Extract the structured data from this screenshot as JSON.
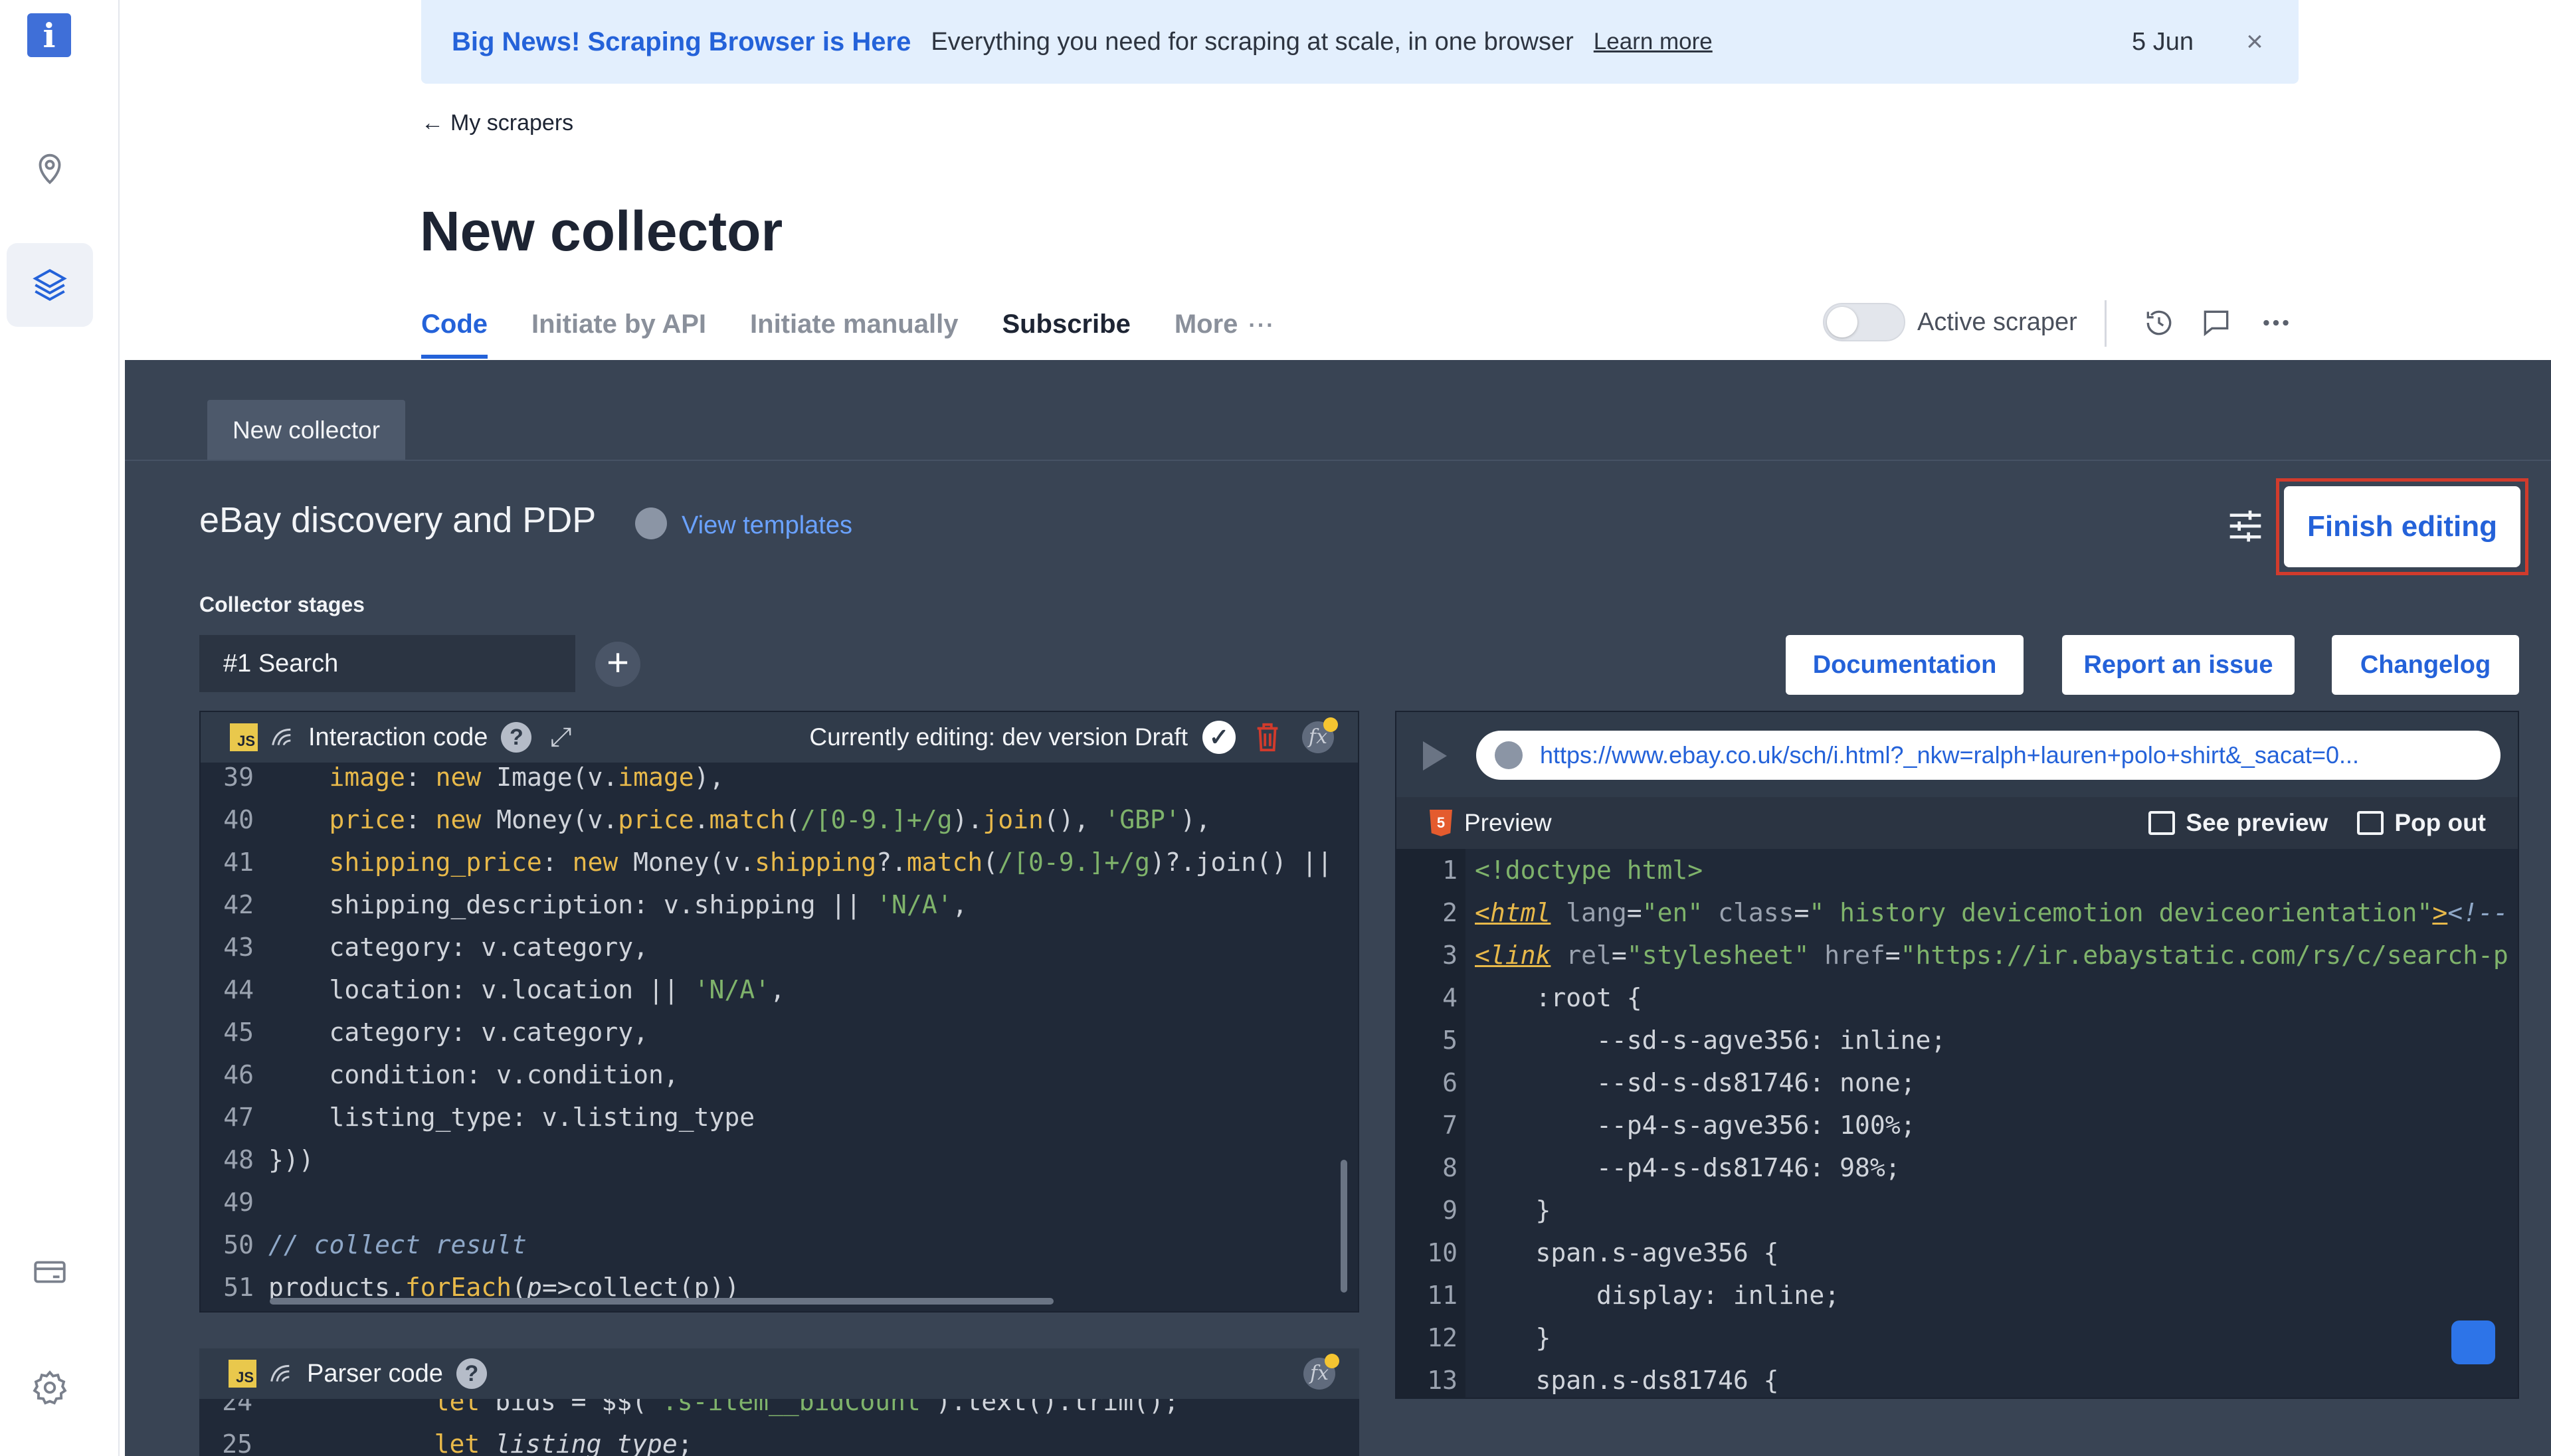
{
  "banner": {
    "title": "Big News! Scraping Browser is Here",
    "text": "Everything you need for scraping at scale, in one browser",
    "link": "Learn more",
    "date": "5 Jun",
    "close_icon": "×"
  },
  "breadcrumb": {
    "back": "My scrapers"
  },
  "page_title": "New collector",
  "tabs": [
    {
      "label": "Code",
      "active": true
    },
    {
      "label": "Initiate by API"
    },
    {
      "label": "Initiate manually"
    },
    {
      "label": "Subscribe"
    },
    {
      "label": "More",
      "suffix": "···"
    }
  ],
  "header": {
    "toggle_label": "Active scraper",
    "toggle_on": false
  },
  "workspace": {
    "tab_label": "New collector",
    "project_title": "eBay discovery and PDP",
    "view_templates": "View templates",
    "finish_editing": "Finish editing",
    "stages_label": "Collector stages",
    "stage_value": "#1  Search",
    "add_stage": "+",
    "buttons": {
      "documentation": "Documentation",
      "report": "Report an issue",
      "changelog": "Changelog"
    }
  },
  "interaction_panel": {
    "badge": "JS",
    "title": "Interaction code",
    "help": "?",
    "editing": "Currently editing: dev version Draft",
    "fx": "fx",
    "lines": [
      {
        "n": "39",
        "html": "    <span class='k'>image</span>: <span class='k'>new</span> Image(v.<span class='k'>image</span>),"
      },
      {
        "n": "40",
        "html": "    <span class='k'>price</span>: <span class='k'>new</span> Money(v.<span class='k'>price</span>.<span class='k'>match</span>(<span class='s'>/[0-9.]+/g</span>).<span class='k'>join</span>(), <span class='s'>'GBP'</span>),"
      },
      {
        "n": "41",
        "html": "    <span class='k'>shipping_price</span>: <span class='k'>new</span> Money(v.<span class='k'>shipping</span>?.<span class='k'>match</span>(<span class='s'>/[0-9.]+/g</span>)?.join() ||"
      },
      {
        "n": "42",
        "html": "    shipping_description: v.shipping || <span class='s'>'N/A'</span>,"
      },
      {
        "n": "43",
        "html": "    category: v.category,"
      },
      {
        "n": "44",
        "html": "    location: v.location || <span class='s'>'N/A'</span>,"
      },
      {
        "n": "45",
        "html": "    category: v.category,"
      },
      {
        "n": "46",
        "html": "    condition: v.condition,"
      },
      {
        "n": "47",
        "html": "    listing_type: v.listing_type"
      },
      {
        "n": "48",
        "html": "}))"
      },
      {
        "n": "49",
        "html": ""
      },
      {
        "n": "50",
        "html": "<span class='cm'>// collect result</span>"
      },
      {
        "n": "51",
        "html": "products.<span class='k'>forEach</span>(<i>p</i>=&gt;collect(p))"
      }
    ]
  },
  "parser_panel": {
    "badge": "JS",
    "title": "Parser code",
    "help": "?",
    "fx": "fx",
    "lines": [
      {
        "n": "24",
        "html": "           <span class='k'>let</span> bids = $$(<span class='s'>'.s-item__bidCount'</span>).text().trim();"
      },
      {
        "n": "25",
        "html": "           <span class='k'>let</span> <i>listing_type</i>;"
      }
    ]
  },
  "preview_panel": {
    "url": "https://www.ebay.co.uk/sch/i.html?_nkw=ralph+lauren+polo+shirt&_sacat=0...",
    "title": "Preview",
    "h5_badge": "5",
    "see_preview": "See preview",
    "pop_out": "Pop out",
    "lines": [
      {
        "n": "1",
        "html": "<span class='val'>&lt;!doctype html&gt;</span>"
      },
      {
        "n": "2",
        "html": "<span class='tag'>&lt;html</span> <span class='attr'>lang</span>=<span class='val'>\"en\"</span> <span class='attr'>class</span>=<span class='val'>\" history devicemotion deviceorientation\"</span><span class='tag'>&gt;</span><span class='cm'>&lt;!--</span>"
      },
      {
        "n": "3",
        "html": "<span class='tag'>&lt;link</span> <span class='attr'>rel</span>=<span class='val'>\"stylesheet\"</span> <span class='attr'>href</span>=<span class='val'>\"https://ir.ebaystatic.com/rs/c/search-p</span>"
      },
      {
        "n": "4",
        "html": "    :root {"
      },
      {
        "n": "5",
        "html": "        --sd-s-agve356: inline;"
      },
      {
        "n": "6",
        "html": "        --sd-s-ds81746: none;"
      },
      {
        "n": "7",
        "html": "        --p4-s-agve356: 100%;"
      },
      {
        "n": "8",
        "html": "        --p4-s-ds81746: 98%;"
      },
      {
        "n": "9",
        "html": "    }"
      },
      {
        "n": "10",
        "html": "    span.s-agve356 {"
      },
      {
        "n": "11",
        "html": "        display: inline;"
      },
      {
        "n": "12",
        "html": "    }"
      },
      {
        "n": "13",
        "html": "    span.s-ds81746 {"
      }
    ]
  },
  "colors": {
    "accent": "#2462d9",
    "dark_bg": "#394454",
    "code_bg": "#202938",
    "highlight_outline": "#d23b2c"
  }
}
